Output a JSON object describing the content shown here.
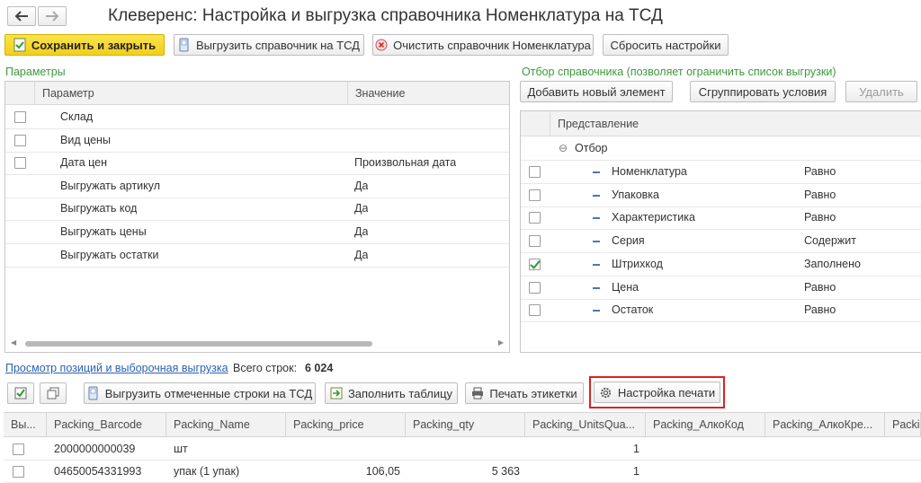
{
  "window": {
    "title": "Клеверенс: Настройка и выгрузка справочника Номенклатура на ТСД"
  },
  "nav": {
    "back": "back-arrow",
    "forward": "forward-arrow"
  },
  "toolbar": {
    "save_close": "Сохранить и закрыть",
    "upload_catalog": "Выгрузить справочник на ТСД",
    "clear_catalog": "Очистить справочник Номенклатура",
    "reset_settings": "Сбросить настройки"
  },
  "params": {
    "label": "Параметры",
    "col_param": "Параметр",
    "col_value": "Значение",
    "rows": [
      {
        "name": "Склад",
        "value": "",
        "checkbox": true
      },
      {
        "name": "Вид цены",
        "value": "",
        "checkbox": true
      },
      {
        "name": "Дата цен",
        "value": "Произвольная дата",
        "checkbox": true
      },
      {
        "name": "Выгружать артикул",
        "value": "Да",
        "checkbox": false
      },
      {
        "name": "Выгружать код",
        "value": "Да",
        "checkbox": false
      },
      {
        "name": "Выгружать цены",
        "value": "Да",
        "checkbox": false
      },
      {
        "name": "Выгружать остатки",
        "value": "Да",
        "checkbox": false
      }
    ]
  },
  "filter": {
    "label": "Отбор справочника (позволяет ограничить список выгрузки)",
    "add_button": "Добавить новый элемент",
    "group_button": "Сгруппировать условия",
    "delete_button": "Удалить",
    "col_repr": "Представление",
    "group_name": "Отбор",
    "rows": [
      {
        "name": "Номенклатура",
        "cond": "Равно",
        "checked": false
      },
      {
        "name": "Упаковка",
        "cond": "Равно",
        "checked": false
      },
      {
        "name": "Характеристика",
        "cond": "Равно",
        "checked": false
      },
      {
        "name": "Серия",
        "cond": "Содержит",
        "checked": false
      },
      {
        "name": "Штрихкод",
        "cond": "Заполнено",
        "checked": true
      },
      {
        "name": "Цена",
        "cond": "Равно",
        "checked": false
      },
      {
        "name": "Остаток",
        "cond": "Равно",
        "checked": false
      }
    ]
  },
  "preview": {
    "link": "Просмотр позиций и выборочная выгрузка",
    "total_label": "Всего строк:",
    "total_value": "6 024",
    "upload_selected": "Выгрузить отмеченные строки на ТСД",
    "fill_table": "Заполнить таблицу",
    "print_labels": "Печать этикетки",
    "print_settings": "Настройка печати",
    "columns": [
      "Вы...",
      "Packing_Barcode",
      "Packing_Name",
      "Packing_price",
      "Packing_qty",
      "Packing_UnitsQua...",
      "Packing_АлкоКод",
      "Packing_АлкоКре...",
      "Packi..."
    ],
    "rows": [
      {
        "barcode": "2000000000039",
        "name": "шт",
        "price": "",
        "qty": "",
        "units": "1"
      },
      {
        "barcode": "04650054331993",
        "name": "упак (1 упак)",
        "price": "106,05",
        "qty": "5 363",
        "units": "1"
      }
    ]
  },
  "colors": {
    "accent_yellow": "#f2cf1d",
    "section_green": "#3d9a3d",
    "link_blue": "#2b62b2",
    "highlight_red": "#e02020"
  }
}
